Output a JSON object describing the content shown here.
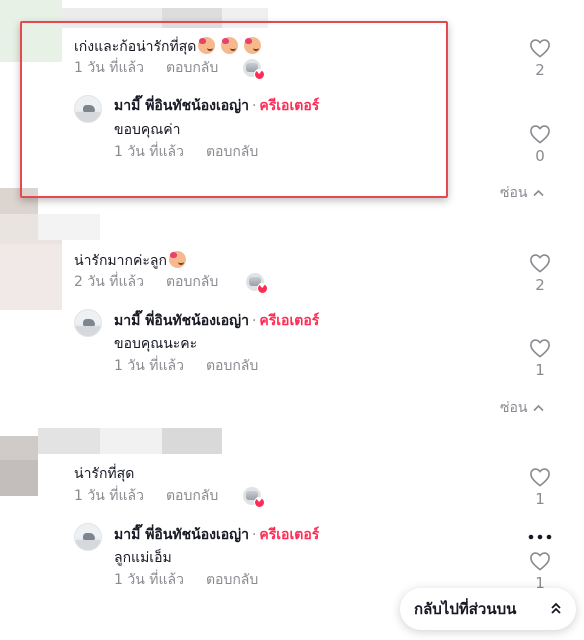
{
  "threads": [
    {
      "comment": {
        "text": "เก่งและก้อน่ารักที่สุด",
        "time": "1 วัน ที่แล้ว",
        "reply": "ตอบกลับ",
        "likes": "2"
      },
      "reply": {
        "author": "มามี๊ พี่อินทัชน้องเอญ่า",
        "separator": "·",
        "badge": "ครีเอเตอร์",
        "text": "ขอบคุณค่า",
        "time": "1 วัน ที่แล้ว",
        "reply": "ตอบกลับ",
        "likes": "0"
      },
      "hide": "ซ่อน"
    },
    {
      "comment": {
        "text": "น่ารักมากค่ะลูก",
        "time": "2 วัน ที่แล้ว",
        "reply": "ตอบกลับ",
        "likes": "2"
      },
      "reply": {
        "author": "มามี๊ พี่อินทัชน้องเอญ่า",
        "separator": "·",
        "badge": "ครีเอเตอร์",
        "text": "ขอบคุณนะคะ",
        "time": "1 วัน ที่แล้ว",
        "reply": "ตอบกลับ",
        "likes": "1"
      },
      "hide": "ซ่อน"
    },
    {
      "comment": {
        "text": "น่ารักที่สุด",
        "time": "1 วัน ที่แล้ว",
        "reply": "ตอบกลับ",
        "likes": "1"
      },
      "reply": {
        "author": "มามี๊ พี่อินทัชน้องเอญ่า",
        "separator": "·",
        "badge": "ครีเอเตอร์",
        "text": "ลูกแม่เอ็ม",
        "time": "1 วัน ที่แล้ว",
        "reply": "ตอบกลับ",
        "likes": "1"
      }
    }
  ],
  "back_to_top": "กลับไปที่ส่วนบน",
  "colors": {
    "accent": "#fe2c55",
    "muted": "#8a8b91",
    "highlight": "#e5484d"
  },
  "icons": [
    "heart-outline-icon",
    "creator-liked-icon",
    "chevron-up-icon",
    "more-icon",
    "double-chevron-up-icon",
    "emoji-icon"
  ]
}
